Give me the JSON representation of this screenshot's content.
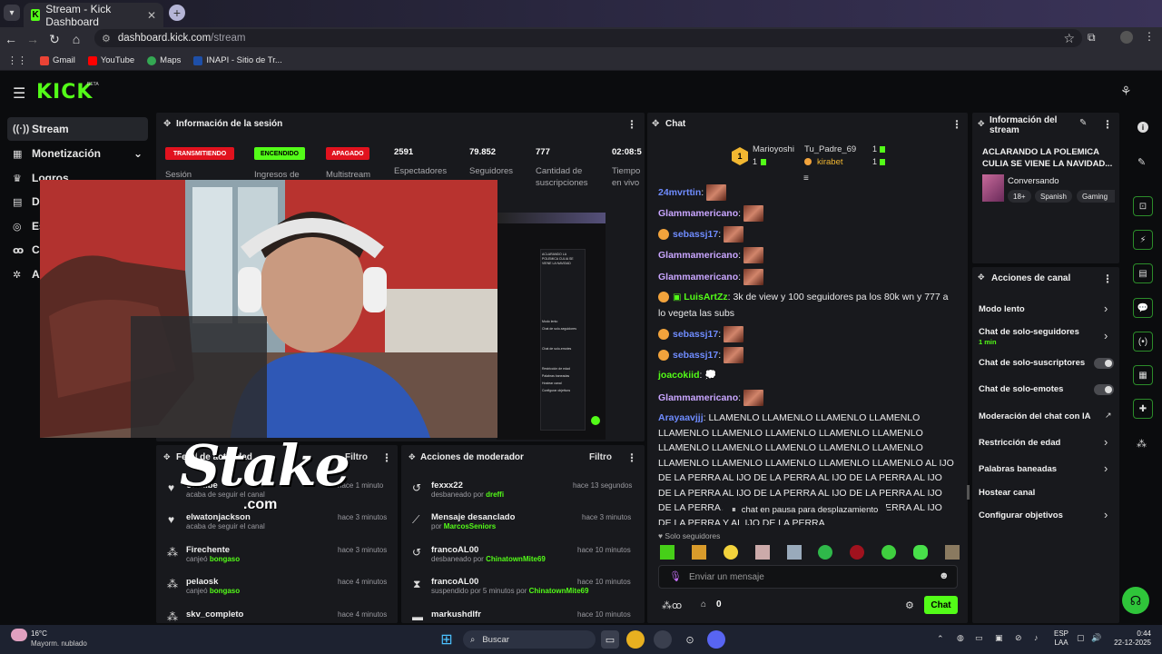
{
  "browser": {
    "tab_title": "Stream - Kick Dashboard",
    "url_host": "dashboard.kick.com",
    "url_path": "/stream",
    "bookmarks": [
      "Gmail",
      "YouTube",
      "Maps",
      "INAPI - Sitio de Tr..."
    ]
  },
  "kick": {
    "logo": "KICK",
    "logo_tag": "BETA"
  },
  "sidebar": {
    "items": [
      {
        "label": "Stream",
        "icon": "stream-icon"
      },
      {
        "label": "Monetización",
        "icon": "dollar-icon"
      },
      {
        "label": "Logros",
        "icon": "trophy-icon"
      },
      {
        "label": "D",
        "icon": "chart-icon"
      },
      {
        "label": "Es",
        "icon": "settings-icon"
      },
      {
        "label": "C",
        "icon": "users-icon"
      },
      {
        "label": "A",
        "icon": "gear-icon"
      }
    ]
  },
  "session": {
    "title": "Información de la sesión",
    "badges": [
      {
        "label": "TRANSMITIENDO",
        "sub": "Sesión",
        "color": "#e1121e",
        "text": "#ffffff"
      },
      {
        "label": "ENCENDIDO",
        "sub": "Ingresos de",
        "color": "#53fc18",
        "text": "#000000"
      },
      {
        "label": "APAGADO",
        "sub": "Multistream",
        "color": "#e1121e",
        "text": "#ffffff"
      }
    ],
    "stats": [
      {
        "value": "2591",
        "label": "Espectadores"
      },
      {
        "value": "79.852",
        "label": "Seguidores"
      },
      {
        "value": "777",
        "label": "Cantidad de suscripciones"
      },
      {
        "value": "02:08:5",
        "label": "Tiempo en vivo"
      }
    ]
  },
  "activity": {
    "title": "Feed de actividad",
    "filter": "Filtro",
    "items": [
      {
        "name": "Undilbe",
        "sub": "acaba de seguir el canal",
        "time": "hace 1 minuto",
        "icon": "heart-icon"
      },
      {
        "name": "elwatonjackson",
        "sub": "acaba de seguir el canal",
        "time": "hace 3 minutos",
        "icon": "heart-icon"
      },
      {
        "name": "Firechente",
        "sub_prefix": "canjeó",
        "sub_user": "bongaso",
        "time": "hace 3 minutos",
        "icon": "points-icon"
      },
      {
        "name": "pelaosk",
        "sub_prefix": "canjeó",
        "sub_user": "bongaso",
        "time": "hace 4 minutos",
        "icon": "points-icon"
      },
      {
        "name": "skv_completo",
        "time": "hace 4 minutos",
        "icon": "points-icon"
      }
    ]
  },
  "modactions": {
    "title": "Acciones de moderador",
    "filter": "Filtro",
    "items": [
      {
        "name": "fexxx22",
        "sub_prefix": "desbaneado por",
        "sub_user": "dreffi",
        "time": "hace 13 segundos"
      },
      {
        "name": "Mensaje desanclado",
        "sub_prefix": "por",
        "sub_user": "MarcosSeniors",
        "time": "hace 3 minutos"
      },
      {
        "name": "francoAL00",
        "sub_prefix": "desbaneado por",
        "sub_user": "ChinatownMite69",
        "time": "hace 10 minutos"
      },
      {
        "name": "francoAL00",
        "sub_prefix": "suspendido por 5 minutos por",
        "sub_user": "ChinatownMite69",
        "time": "hace 10 minutos"
      },
      {
        "name": "markushdlfr",
        "time": "hace 10 minutos"
      }
    ]
  },
  "chat": {
    "title": "Chat",
    "top_gifters": [
      {
        "name": "Marioyoshi",
        "count": "1"
      },
      {
        "name": "Tu_Padre_69",
        "count": "1"
      },
      {
        "name": "kirabet",
        "count": "1"
      }
    ],
    "messages": [
      {
        "user": "24mvrttin",
        "color": "#6f8cff",
        "text": "",
        "emote": true
      },
      {
        "user": "Glammamericano",
        "color": "#c9a6ff",
        "text": "",
        "emote": true
      },
      {
        "user": "sebassj17",
        "color": "#6f8cff",
        "text": "",
        "emote": true,
        "badge": true
      },
      {
        "user": "Glammamericano",
        "color": "#c9a6ff",
        "text": "",
        "emote": true
      },
      {
        "user": "Glammamericano",
        "color": "#c9a6ff",
        "text": "",
        "emote": true
      },
      {
        "user": "LuisArtZz",
        "color": "#53fc18",
        "text": "3k de view y 100 seguidores pa los 80k wn y 777 a lo vegeta las subs",
        "badge": true
      },
      {
        "user": "sebassj17",
        "color": "#6f8cff",
        "text": "",
        "emote": true,
        "badge": true
      },
      {
        "user": "sebassj17",
        "color": "#6f8cff",
        "text": "",
        "emote": true,
        "badge": true
      },
      {
        "user": "joacokiid",
        "color": "#53fc18",
        "text": "💭"
      },
      {
        "user": "Glammamericano",
        "color": "#c9a6ff",
        "text": "",
        "emote": true
      },
      {
        "user": "Arayaavjjj",
        "color": "#6f8cff",
        "text": "LLAMENLO LLAMENLO LLAMENLO LLAMENLO LLAMENLO LLAMENLO LLAMENLO LLAMENLO LLAMENLO LLAMENLO LLAMENLO LLAMENLO LLAMENLO LLAMENLO LLAMENLO LLAMENLO LLAMENLO LLAMENLO LLAMENLO AL IJO DE LA PERRA AL IJO DE LA PERRA AL IJO DE LA PERRA AL IJO DE LA PERRA AL IJO DE LA PERRA AL IJO DE LA PERRA AL IJO DE LA PERRA AL IJO DE LA PERRA AL IJO DE LA PERRA AL IJO DE LA PERRA Y AL IJO DE LA PERRA"
      }
    ],
    "pause_notice": "chat en pausa para desplazamiento",
    "followers_only": "Solo seguidores",
    "input_placeholder": "Enviar un mensaje",
    "points": "0",
    "send": "Chat"
  },
  "streaminfo": {
    "title": "Información del stream",
    "stream_title": "ACLARANDO LA POLEMICA CULIA SE VIENE LA NAVIDAD...",
    "category": "Conversando",
    "tags": [
      "18+",
      "Spanish",
      "Gaming"
    ]
  },
  "channel_actions": {
    "title": "Acciones de canal",
    "items": [
      {
        "label": "Modo lento",
        "type": "chevron"
      },
      {
        "label": "Chat de solo-seguidores",
        "sub": "1 min",
        "type": "chevron"
      },
      {
        "label": "Chat de solo-suscriptores",
        "type": "toggle"
      },
      {
        "label": "Chat de solo-emotes",
        "type": "toggle"
      },
      {
        "label": "Moderación del chat con IA",
        "type": "external"
      },
      {
        "label": "Restricción de edad",
        "type": "chevron"
      },
      {
        "label": "Palabras baneadas",
        "type": "chevron"
      },
      {
        "label": "Hostear canal",
        "type": "none"
      },
      {
        "label": "Configurar objetivos",
        "type": "chevron"
      }
    ]
  },
  "overlay": {
    "brand": "Stake",
    "brand_tld": ".com",
    "panel_mini": [
      "ACLARANDO LA POLEMICA CULIA SE VIENE LA NAVIDAD",
      "Modo lento",
      "Chat de solo-seguidores",
      "Chat de solo-emotes",
      "Restricción de edad",
      "Palabras baneadas",
      "Hostear canal",
      "Configurar objetivos"
    ]
  },
  "taskbar": {
    "weather_temp": "16°C",
    "weather_desc": "Mayorm. nublado",
    "search": "Buscar",
    "lang1": "ESP",
    "lang2": "LAA",
    "time": "0:44",
    "date": "22-12-2025"
  },
  "colors": {
    "kick_green": "#53fc18",
    "live_red": "#e1121e",
    "panel": "#18191d"
  }
}
